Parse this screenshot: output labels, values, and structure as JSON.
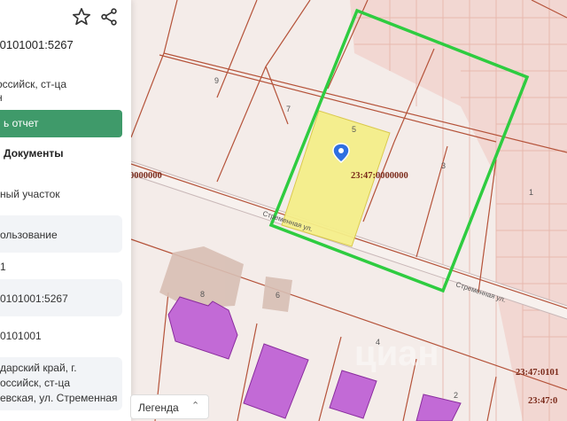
{
  "panel": {
    "cadastral_number": ":0101001:5267",
    "address_line1": "оссийск, ст-ца",
    "address_line2": "н",
    "report_button": "ь отчет",
    "documents_tab": "Документы",
    "fields": [
      "ный участок",
      "ользование",
      "1",
      "0101001:5267",
      "0101001",
      "дарский край, г.",
      "оссийск, ст-ца",
      "евская, ул. Стременная"
    ]
  },
  "map": {
    "plot_numbers": [
      "9",
      "7",
      "5",
      "3",
      "1",
      "8",
      "6",
      "4",
      "2"
    ],
    "quarter_label_left": "0000000",
    "quarter_label_center": "23:47:0000000",
    "quarter_label_right": "23:47:0101",
    "quarter_label_bottom_right": "23:47:0",
    "street_label_1": "Стременная ул.",
    "street_label_2": "Стременная ул.",
    "watermark": "циан"
  },
  "legend": {
    "label": "Легенда"
  },
  "colors": {
    "accent_green": "#3f9a6a",
    "boundary_green": "#2ecc40",
    "selected_plot": "#f5ef8a",
    "building": "#c26ad6",
    "cadastral_line": "#b5533a"
  },
  "icons": [
    "star-icon",
    "share-icon",
    "location-pin-icon",
    "chevron-up-icon"
  ]
}
